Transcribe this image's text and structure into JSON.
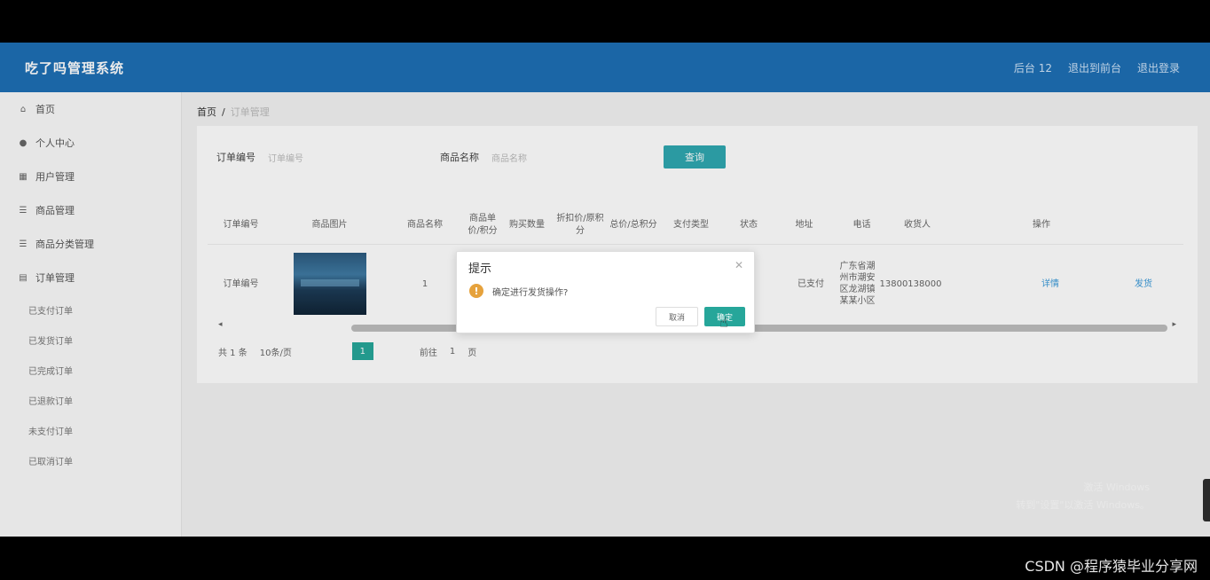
{
  "app": {
    "title": "吃了吗管理系统"
  },
  "header_actions": [
    "后台 12",
    "退出到前台",
    "退出登录"
  ],
  "sidebar": {
    "items": [
      {
        "label": "首页",
        "icon": "home-icon"
      },
      {
        "label": "个人中心",
        "icon": "user-icon"
      },
      {
        "label": "用户管理",
        "icon": "grid-icon"
      },
      {
        "label": "商品管理",
        "icon": "list-icon"
      },
      {
        "label": "商品分类管理",
        "icon": "list-icon"
      },
      {
        "label": "订单管理",
        "icon": "order-icon"
      }
    ],
    "subitems": [
      "已支付订单",
      "已发货订单",
      "已完成订单",
      "已退款订单",
      "未支付订单",
      "已取消订单"
    ]
  },
  "breadcrumb": {
    "home": "首页",
    "separator": "/",
    "current": "订单管理"
  },
  "search": {
    "field1_label": "订单编号",
    "field1_placeholder": "订单编号",
    "field2_label": "商品名称",
    "field2_placeholder": "商品名称",
    "button": "查询"
  },
  "table": {
    "headers": [
      "订单编号",
      "商品图片",
      "商品名称",
      "商品单价/积分",
      "购买数量",
      "折扣价/原积分",
      "总价/总积分",
      "支付类型",
      "状态",
      "地址",
      "电话",
      "收货人",
      "操作"
    ],
    "rows": [
      {
        "order_no": "订单编号",
        "qty": "1",
        "status": "已支付",
        "address": "广东省潮州市潮安区龙湖镇某某小区",
        "phone": "13800138000",
        "actions": [
          "详情",
          "发货"
        ]
      }
    ]
  },
  "pagination": {
    "total": "共 1 条",
    "page_size": "10条/页",
    "current_page": "1",
    "goto_label": "前往",
    "goto_value": "1",
    "page_unit": "页"
  },
  "dialog": {
    "title": "提示",
    "message": "确定进行发货操作?",
    "cancel": "取消",
    "confirm": "确定",
    "icon": "warning-icon"
  },
  "watermark": [
    "激活 Windows",
    "转到\"设置\"以激活 Windows。"
  ],
  "footer_watermark": "CSDN @程序猿毕业分享网",
  "colors": {
    "header": "#1e6fb5",
    "accent": "#26a69a",
    "search_button": "#2fa8b0",
    "warning": "#e6a23c"
  }
}
